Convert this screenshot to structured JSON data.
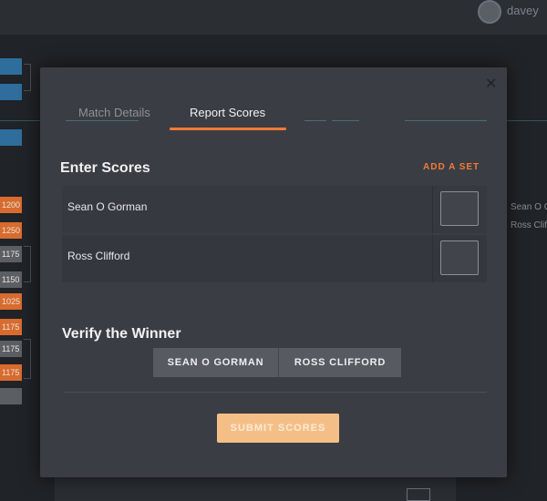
{
  "background": {
    "username": "davey",
    "seed_chips": [
      "1200",
      "1250",
      "1175",
      "1150",
      "1025",
      "1175",
      "1175",
      "1175"
    ],
    "right_names": [
      "Sean O Gorm",
      "Ross Cliffor"
    ]
  },
  "modal": {
    "close_icon": "close-icon",
    "tabs": [
      {
        "label": "Match Details",
        "active": false
      },
      {
        "label": "Report Scores",
        "active": true
      }
    ],
    "enter_scores": {
      "title": "Enter Scores",
      "add_set_label": "ADD A SET",
      "players": [
        {
          "name": "Sean O Gorman",
          "score": ""
        },
        {
          "name": "Ross Clifford",
          "score": ""
        }
      ]
    },
    "verify_winner": {
      "title": "Verify the Winner",
      "options": [
        "SEAN O GORMAN",
        "ROSS CLIFFORD"
      ]
    },
    "submit_label": "SUBMIT SCORES"
  },
  "colors": {
    "accent": "#f47a35",
    "submit_button": "#f4bf86",
    "modal_bg": "#3a3e44"
  }
}
